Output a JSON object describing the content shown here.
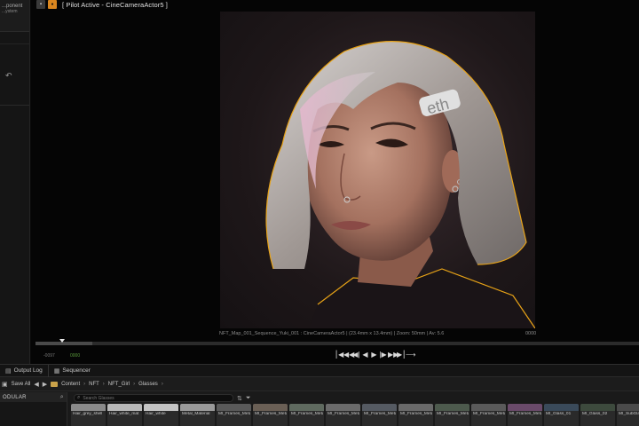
{
  "left_panel": {
    "line1": "...ponent",
    "line2": "...ystem",
    "icon": "undo-icon"
  },
  "viewport": {
    "title": "[ Pilot Active - CineCameraActor5 ]",
    "header_icons": [
      "camera-icon",
      "pilot-badge-icon"
    ],
    "camera_info": "NFT_Map_001_Sequence_Yuki_001 : CineCameraActor5 | (23.4mm x 13.4mm) | Zoom: 50mm | Av: 5.6",
    "frame_number": "0000"
  },
  "timeline": {
    "start_label": "-0097",
    "current_label": "0000",
    "transport_icons": [
      "to-start-icon",
      "prev-key-icon",
      "step-back-icon",
      "play-reverse-icon",
      "play-icon",
      "step-forward-icon",
      "next-key-icon",
      "to-end-icon",
      "loop-icon"
    ],
    "transport_glyphs": [
      "⎮◀",
      "◀◀",
      "◀|",
      "◀",
      "▶",
      "|▶",
      "▶▶",
      "▶⎮",
      "⟶"
    ]
  },
  "dock": {
    "tabs": [
      {
        "label": "Output Log",
        "icon": "log-icon"
      },
      {
        "label": "Sequencer",
        "icon": "sequencer-icon"
      }
    ],
    "toolbar": {
      "save_all": "Save All",
      "breadcrumbs": [
        "Content",
        "NFT",
        "NFT_Girl",
        "Glasses"
      ]
    },
    "left_header": "ODULAR",
    "search_placeholder": "Search Glasses",
    "assets": [
      {
        "label": "Hair_grey_shell",
        "color": "#8a8a8a"
      },
      {
        "label": "Hair_white_mat",
        "color": "#b8b8b8"
      },
      {
        "label": "Hair_white",
        "color": "#c4c4c4"
      },
      {
        "label": "Metal_Material",
        "color": "#9a9a9a"
      },
      {
        "label": "MI_Frames_Metal_01",
        "color": "#5a5a5a"
      },
      {
        "label": "MI_Frames_Metal_02",
        "color": "#6a5f55"
      },
      {
        "label": "MI_Frames_Metal_03",
        "color": "#5f6a5f"
      },
      {
        "label": "MI_Frames_Metal_04",
        "color": "#6b6b6b"
      },
      {
        "label": "MI_Frames_Metal_05",
        "color": "#555a62"
      },
      {
        "label": "MI_Frames_Metal_06",
        "color": "#6a6a6a"
      },
      {
        "label": "MI_Frames_Metal_07",
        "color": "#4d5a4d"
      },
      {
        "label": "MI_Frames_Metal_08",
        "color": "#5a5a5a"
      },
      {
        "label": "MI_Frames_Metal_09",
        "color": "#6a4a6a"
      },
      {
        "label": "MI_Glass_01",
        "color": "#3a4a5a"
      },
      {
        "label": "MI_Glass_02",
        "color": "#3d4a3d"
      },
      {
        "label": "MI_SubGlass_Frames",
        "color": "#4a4a4a"
      }
    ]
  },
  "colors": {
    "accent_orange": "#d9861f",
    "selection_outline": "#e8a317"
  }
}
